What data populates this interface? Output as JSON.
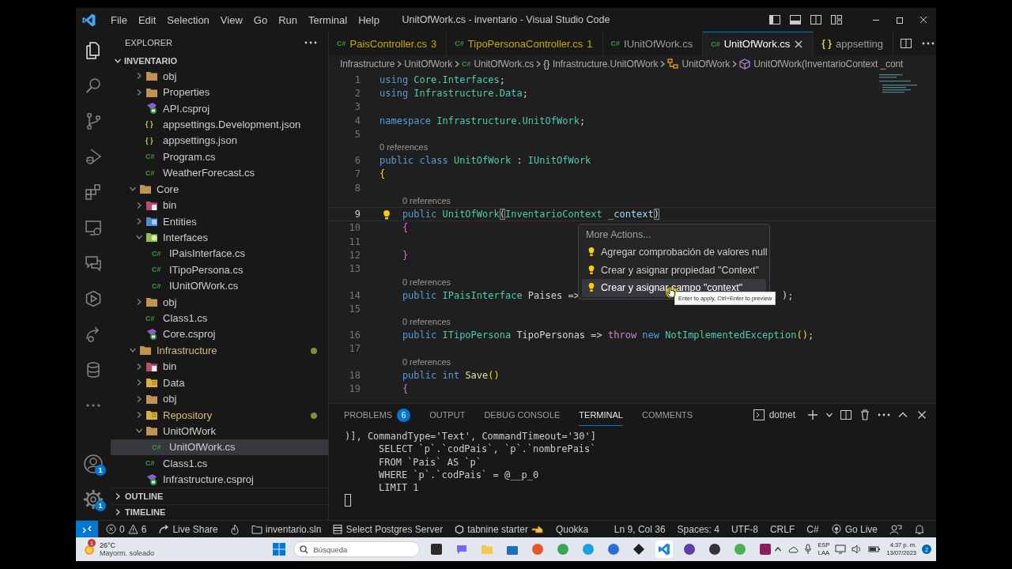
{
  "title_bar": {
    "menu": [
      "File",
      "Edit",
      "Selection",
      "View",
      "Go",
      "Run",
      "Terminal",
      "Help"
    ],
    "title": "UnitOfWork.cs - inventario - Visual Studio Code"
  },
  "activity_bar": {
    "items": [
      {
        "kind": "explorer",
        "selected": true
      },
      {
        "kind": "search",
        "selected": false
      },
      {
        "kind": "source-control",
        "selected": false
      },
      {
        "kind": "run-debug",
        "selected": false
      },
      {
        "kind": "extensions",
        "selected": false
      },
      {
        "kind": "remote",
        "selected": false
      },
      {
        "kind": "comments",
        "selected": false
      },
      {
        "kind": "testing",
        "selected": false
      },
      {
        "kind": "live-share",
        "selected": false
      },
      {
        "kind": "database",
        "selected": false
      },
      {
        "kind": "more",
        "selected": false
      }
    ],
    "account_badge": "1",
    "settings_badge": "1"
  },
  "explorer": {
    "title": "EXPLORER",
    "root": "INVENTARIO",
    "continued_children": [
      {
        "label": "obj",
        "kind": "folder",
        "expanded": false,
        "selected": false,
        "warning": false
      },
      {
        "label": "Properties",
        "kind": "folder",
        "expanded": false,
        "selected": false,
        "warning": false
      },
      {
        "label": "API.csproj",
        "kind": "csproj",
        "selected": false,
        "warning": false
      },
      {
        "label": "appsettings.Development.json",
        "kind": "json",
        "glyph": "{ }",
        "selected": false,
        "warning": false
      },
      {
        "label": "appsettings.json",
        "kind": "json",
        "glyph": "{ }",
        "selected": false,
        "warning": false
      },
      {
        "label": "Program.cs",
        "kind": "cs",
        "glyph": "C#",
        "selected": false,
        "warning": false
      },
      {
        "label": "WeatherForecast.cs",
        "kind": "cs",
        "glyph": "C#",
        "selected": false,
        "warning": false
      }
    ],
    "items": [
      {
        "label": "Core",
        "kind": "folder",
        "expanded": true,
        "selected": false,
        "warning": false,
        "children": [
          {
            "label": "bin",
            "kind": "folder-bin",
            "expanded": false,
            "selected": false,
            "warning": false
          },
          {
            "label": "Entities",
            "kind": "folder-entities",
            "expanded": false,
            "selected": false,
            "warning": false
          },
          {
            "label": "Interfaces",
            "kind": "folder-interfaces",
            "expanded": true,
            "selected": false,
            "warning": false,
            "children": [
              {
                "label": "IPaisInterface.cs",
                "kind": "cs",
                "glyph": "C#",
                "selected": false,
                "warning": false
              },
              {
                "label": "ITipoPersona.cs",
                "kind": "cs",
                "glyph": "C#",
                "selected": false,
                "warning": false
              },
              {
                "label": "IUnitOfWork.cs",
                "kind": "cs",
                "glyph": "C#",
                "selected": false,
                "warning": false
              }
            ]
          },
          {
            "label": "obj",
            "kind": "folder",
            "expanded": false,
            "selected": false,
            "warning": false
          },
          {
            "label": "Class1.cs",
            "kind": "cs",
            "glyph": "C#",
            "selected": false,
            "warning": false
          },
          {
            "label": "Core.csproj",
            "kind": "csproj",
            "selected": false,
            "warning": false
          }
        ]
      },
      {
        "label": "Infrastructure",
        "kind": "folder",
        "expanded": true,
        "selected": false,
        "warning": true,
        "children": [
          {
            "label": "bin",
            "kind": "folder-bin",
            "expanded": false,
            "selected": false,
            "warning": false
          },
          {
            "label": "Data",
            "kind": "folder-data",
            "expanded": false,
            "selected": false,
            "warning": false
          },
          {
            "label": "obj",
            "kind": "folder",
            "expanded": false,
            "selected": false,
            "warning": false
          },
          {
            "label": "Repository",
            "kind": "folder-data",
            "expanded": false,
            "selected": false,
            "warning": true
          },
          {
            "label": "UnitOfWork",
            "kind": "folder",
            "expanded": true,
            "selected": false,
            "warning": false,
            "children": [
              {
                "label": "UnitOfWork.cs",
                "kind": "cs",
                "glyph": "C#",
                "selected": true,
                "warning": false
              }
            ]
          },
          {
            "label": "Class1.cs",
            "kind": "cs",
            "glyph": "C#",
            "selected": false,
            "warning": false
          },
          {
            "label": "Infrastructure.csproj",
            "kind": "csproj",
            "selected": false,
            "warning": false
          }
        ]
      }
    ],
    "sections": [
      "OUTLINE",
      "TIMELINE"
    ]
  },
  "tabs": [
    {
      "glyph": "C#",
      "label": "PaisController.cs",
      "badge": "3",
      "selected": false
    },
    {
      "glyph": "C#",
      "label": "TipoPersonaController.cs",
      "badge": "1",
      "selected": false
    },
    {
      "glyph": "C#",
      "label": "IUnitOfWork.cs",
      "selected": false
    },
    {
      "glyph": "C#",
      "label": "UnitOfWork.cs",
      "selected": true
    },
    {
      "glyph": "{ }",
      "label": "appsetting",
      "selected": false
    }
  ],
  "breadcrumbs": [
    {
      "kind": "folder",
      "label": "Infrastructure"
    },
    {
      "kind": "folder",
      "label": "UnitOfWork"
    },
    {
      "kind": "file",
      "glyph": "C#",
      "label": "UnitOfWork.cs"
    },
    {
      "kind": "namespace",
      "glyph": "{}",
      "label": "Infrastructure.UnitOfWork"
    },
    {
      "kind": "class",
      "label": "UnitOfWork"
    },
    {
      "kind": "method",
      "label": "UnitOfWork(InventarioContext _cont"
    }
  ],
  "code_lines": [
    {
      "kind": "code",
      "number": "1",
      "indented": false,
      "current": false,
      "tokens": [
        {
          "kind": "keyword",
          "text": "using "
        },
        {
          "kind": "type",
          "text": "Core.Interfaces"
        },
        {
          "kind": "plain",
          "text": ";"
        }
      ]
    },
    {
      "kind": "code",
      "number": "2",
      "indented": false,
      "current": false,
      "tokens": [
        {
          "kind": "keyword",
          "text": "using "
        },
        {
          "kind": "type",
          "text": "Infrastructure.Data"
        },
        {
          "kind": "plain",
          "text": ";"
        }
      ]
    },
    {
      "kind": "code",
      "number": "3",
      "current": false
    },
    {
      "kind": "code",
      "number": "4",
      "indented": false,
      "current": false,
      "tokens": [
        {
          "kind": "keyword",
          "text": "namespace "
        },
        {
          "kind": "type",
          "text": "Infrastructure.UnitOfWork"
        },
        {
          "kind": "plain",
          "text": ";"
        }
      ]
    },
    {
      "kind": "code",
      "number": "5",
      "current": false
    },
    {
      "kind": "codelens",
      "text": "0 references",
      "indented": false
    },
    {
      "kind": "code",
      "number": "6",
      "indented": false,
      "current": false,
      "tokens": [
        {
          "kind": "keyword",
          "text": "public class "
        },
        {
          "kind": "type",
          "text": "UnitOfWork"
        },
        {
          "kind": "plain",
          "text": " : "
        },
        {
          "kind": "type",
          "text": "IUnitOfWork"
        }
      ]
    },
    {
      "kind": "code",
      "number": "7",
      "indented": false,
      "current": false,
      "tokens": [
        {
          "kind": "brace1",
          "text": "{"
        }
      ]
    },
    {
      "kind": "code",
      "number": "8",
      "current": false
    },
    {
      "kind": "codelens",
      "text": "0 references",
      "indented": true
    },
    {
      "kind": "code",
      "number": "9",
      "indented": true,
      "current": true,
      "tokens": [
        {
          "kind": "keyword",
          "text": "public "
        },
        {
          "kind": "type",
          "text": "UnitOfWork"
        },
        {
          "kind": "bracket-match",
          "text": "("
        },
        {
          "kind": "type",
          "text": "InventarioContext "
        },
        {
          "kind": "param",
          "text": "_context"
        },
        {
          "kind": "bracket-match",
          "text": ")"
        }
      ]
    },
    {
      "kind": "code",
      "number": "10",
      "indented": true,
      "current": false,
      "tokens": [
        {
          "kind": "brace2",
          "text": "{"
        }
      ]
    },
    {
      "kind": "code",
      "number": "11",
      "current": false
    },
    {
      "kind": "code",
      "number": "12",
      "indented": true,
      "current": false,
      "tokens": [
        {
          "kind": "brace2",
          "text": "}"
        }
      ]
    },
    {
      "kind": "code",
      "number": "13",
      "current": false
    },
    {
      "kind": "codelens",
      "text": "0 references",
      "indented": true
    },
    {
      "kind": "code",
      "number": "14",
      "indented": true,
      "current": false,
      "tokens": [
        {
          "kind": "keyword",
          "text": "public "
        },
        {
          "kind": "type",
          "text": "IPaisInterface "
        },
        {
          "kind": "plain",
          "text": "Paises => "
        },
        {
          "kind": "covered-tail",
          "text": ");"
        }
      ]
    },
    {
      "kind": "code",
      "number": "15",
      "current": false
    },
    {
      "kind": "codelens",
      "text": "0 references",
      "indented": true
    },
    {
      "kind": "code",
      "number": "16",
      "indented": true,
      "current": false,
      "tokens": [
        {
          "kind": "keyword",
          "text": "public "
        },
        {
          "kind": "type",
          "text": "ITipoPersona "
        },
        {
          "kind": "plain",
          "text": "TipoPersonas => "
        },
        {
          "kind": "control",
          "text": "throw "
        },
        {
          "kind": "keyword",
          "text": "new "
        },
        {
          "kind": "type",
          "text": "NotImplementedException"
        },
        {
          "kind": "brace1",
          "text": "()"
        },
        {
          "kind": "plain",
          "text": ";"
        }
      ]
    },
    {
      "kind": "code",
      "number": "17",
      "current": false
    },
    {
      "kind": "codelens",
      "text": "0 references",
      "indented": true
    },
    {
      "kind": "code",
      "number": "18",
      "indented": true,
      "current": false,
      "tokens": [
        {
          "kind": "keyword",
          "text": "public int "
        },
        {
          "kind": "function",
          "text": "Save"
        },
        {
          "kind": "brace1",
          "text": "()"
        }
      ]
    },
    {
      "kind": "code",
      "number": "19",
      "indented": true,
      "current": false,
      "tokens": [
        {
          "kind": "brace2",
          "text": "{"
        }
      ]
    }
  ],
  "code_actions": {
    "title": "More Actions...",
    "items": [
      {
        "label": "Agregar comprobación de valores null",
        "selected": false
      },
      {
        "label": "Crear y asignar propiedad \"Context\"",
        "selected": false
      },
      {
        "label": "Crear y asignar campo \"context\"",
        "selected": true
      }
    ],
    "tooltip": "Enter to apply, Ctrl+Enter to preview"
  },
  "panel": {
    "tabs": [
      {
        "label": "PROBLEMS",
        "badge": "6",
        "selected": false
      },
      {
        "label": "OUTPUT",
        "selected": false
      },
      {
        "label": "DEBUG CONSOLE",
        "selected": false
      },
      {
        "label": "TERMINAL",
        "selected": true
      },
      {
        "label": "COMMENTS",
        "selected": false
      }
    ],
    "terminal_name": "dotnet",
    "terminal_lines": [
      {
        "text": ")], CommandType='Text', CommandTimeout='30']",
        "indented": false
      },
      {
        "text": "SELECT `p`.`codPais`, `p`.`nombrePais`",
        "indented": true
      },
      {
        "text": "FROM `Pais` AS `p`",
        "indented": true
      },
      {
        "text": "WHERE `p`.`codPais` = @__p_0",
        "indented": true
      },
      {
        "text": "LIMIT 1",
        "indented": true
      }
    ]
  },
  "status_bar": {
    "left": [
      {
        "kind": "remote"
      },
      {
        "kind": "problems",
        "errors": "0",
        "warnings": "6"
      },
      {
        "kind": "live-share",
        "label": "Live Share"
      },
      {
        "kind": "flame"
      },
      {
        "kind": "solution",
        "label": "inventario.sln"
      },
      {
        "kind": "database",
        "label": "Select Postgres Server"
      },
      {
        "kind": "tabnine",
        "label": "tabnine starter"
      },
      {
        "kind": "text",
        "label": "Quokka"
      }
    ],
    "right": [
      {
        "kind": "text",
        "label": "Ln 9, Col 36"
      },
      {
        "kind": "text",
        "label": "Spaces: 4"
      },
      {
        "kind": "text",
        "label": "UTF-8"
      },
      {
        "kind": "text",
        "label": "CRLF"
      },
      {
        "kind": "text",
        "label": "C#"
      },
      {
        "kind": "go-live",
        "label": "Go Live"
      },
      {
        "kind": "feedback"
      },
      {
        "kind": "bell"
      }
    ]
  },
  "taskbar": {
    "weather": {
      "temperature": "26°C",
      "condition": "Mayorm. soleado",
      "badge": "1"
    },
    "search_placeholder": "Búsqueda",
    "apps": [
      {
        "kind": "square",
        "color": "#2b2b2b",
        "selected": false
      },
      {
        "kind": "chat",
        "color": "#7b68ee",
        "selected": false
      },
      {
        "kind": "folder",
        "color": "#f2c94c",
        "selected": false
      },
      {
        "kind": "store",
        "color": "#1f6fbf",
        "selected": false
      },
      {
        "kind": "round",
        "color": "#e8562b",
        "selected": false
      },
      {
        "kind": "round",
        "color": "#3aa757",
        "selected": false
      },
      {
        "kind": "round",
        "color": "#1ba0e2",
        "selected": false
      },
      {
        "kind": "round",
        "color": "#2f6fdc",
        "selected": false
      },
      {
        "kind": "diamond",
        "color": "#222222",
        "selected": false
      },
      {
        "kind": "code",
        "color": "#1e88e5",
        "selected": true
      },
      {
        "kind": "round",
        "color": "#5b3fa8",
        "selected": false
      },
      {
        "kind": "round",
        "color": "#333333",
        "selected": false
      },
      {
        "kind": "round",
        "color": "#4caf50",
        "selected": false
      },
      {
        "kind": "square",
        "color": "#8e1f5b",
        "selected": false
      }
    ],
    "language": [
      "ESP",
      "LAA"
    ],
    "time": "4:37 p. m.",
    "date": "13/07/2023",
    "notifications": "2"
  }
}
